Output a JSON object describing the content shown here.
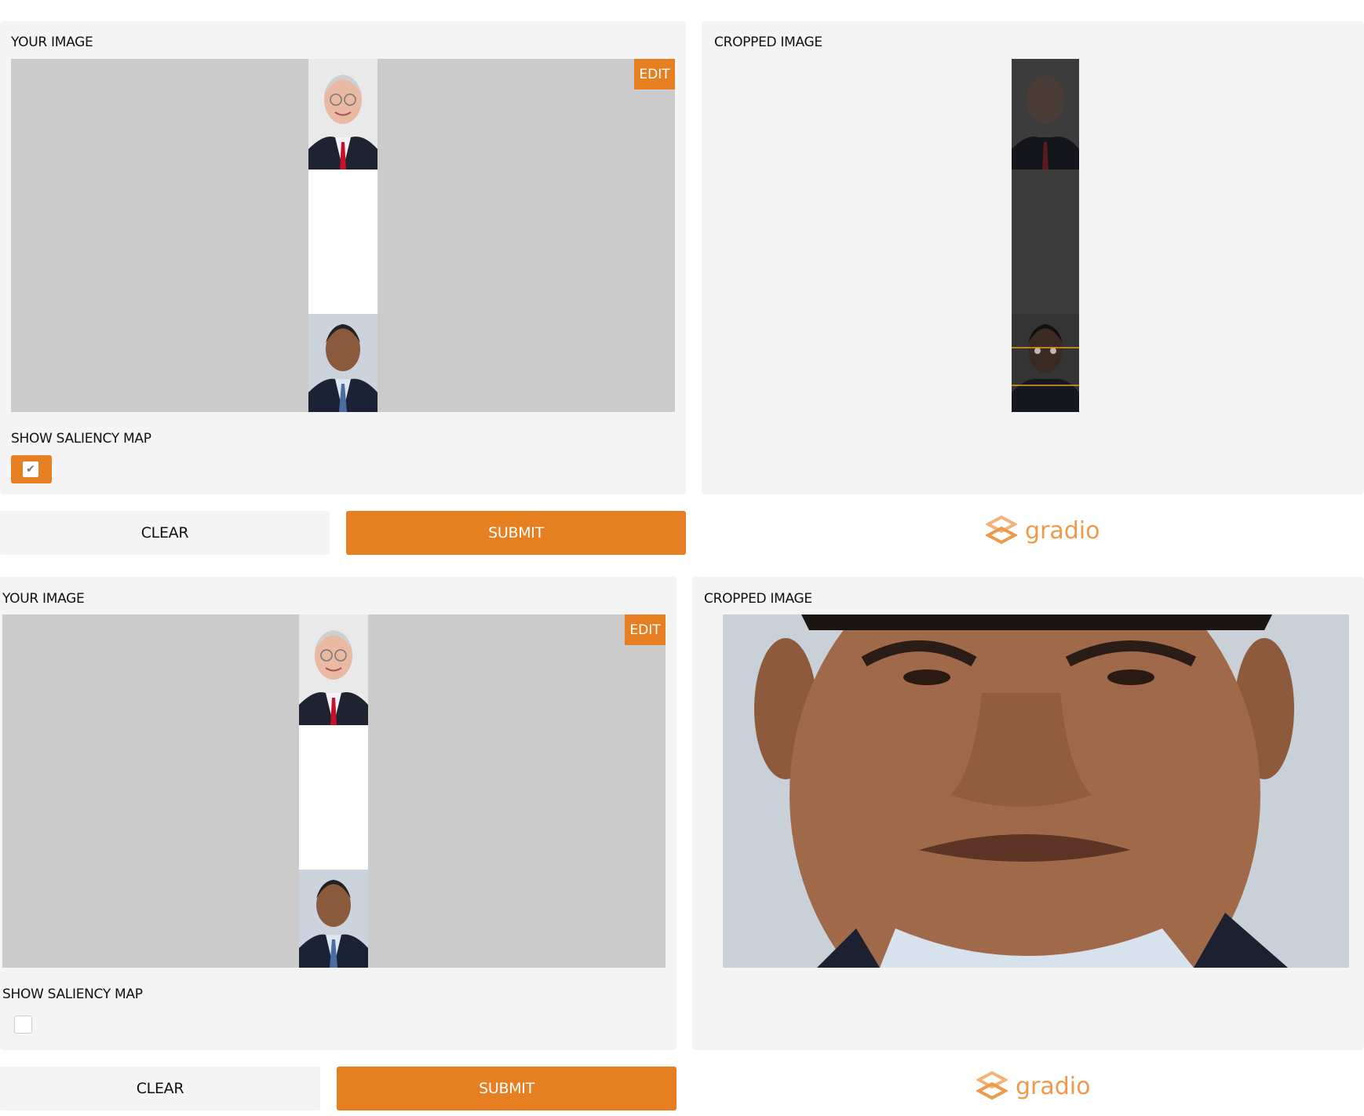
{
  "sections": [
    {
      "input_label": "YOUR IMAGE",
      "edit_label": "EDIT",
      "saliency_label": "SHOW SALIENCY MAP",
      "saliency_checked": true,
      "clear_label": "CLEAR",
      "submit_label": "SUBMIT",
      "output_label": "CROPPED IMAGE",
      "brand": "gradio"
    },
    {
      "input_label": "YOUR IMAGE",
      "edit_label": "EDIT",
      "saliency_label": "SHOW SALIENCY MAP",
      "saliency_checked": false,
      "clear_label": "CLEAR",
      "submit_label": "SUBMIT",
      "output_label": "CROPPED IMAGE",
      "brand": "gradio"
    }
  ],
  "colors": {
    "accent": "#e67e22",
    "panel": "#f4f4f4",
    "image_bg": "#cbcbcb",
    "brand": "#ee9a4d"
  }
}
